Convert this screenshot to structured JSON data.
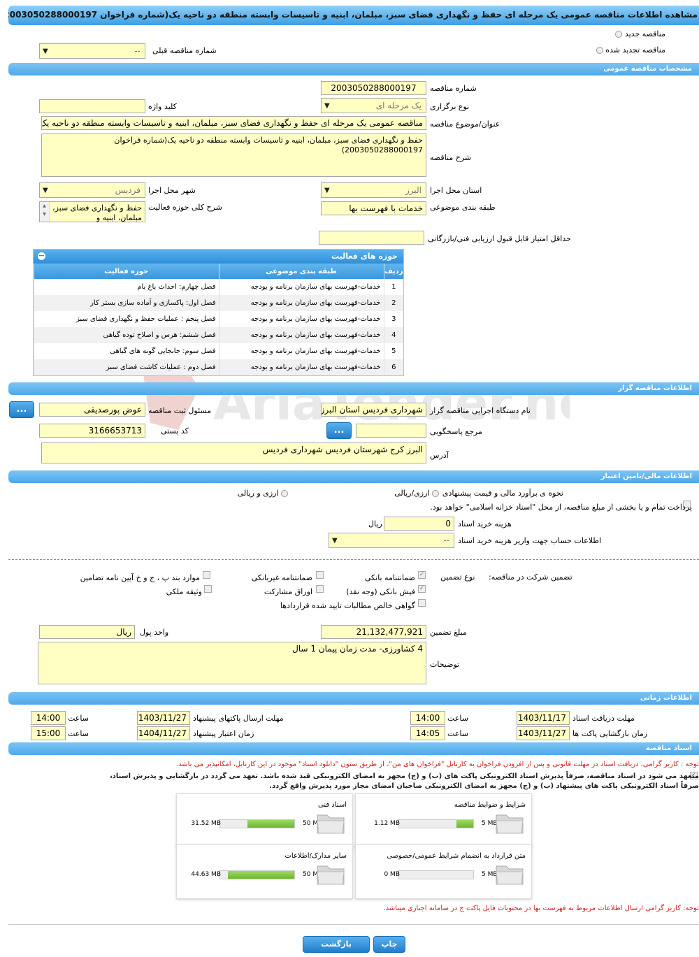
{
  "page_title": "مشاهده اطلاعات مناقصه عمومی یک مرحله ای حفظ و نگهداری فضای سبز، مبلمان، ابنیه و تاسیسات وابسته منطقه دو ناحیه یک(شماره فراخوان 2003050288000197)",
  "top": {
    "new_tender": "مناقصه جدید",
    "renewed_tender": "مناقصه تجدید شده",
    "prev_number_label": "شماره مناقصه قبلی",
    "prev_number_value": "--"
  },
  "general": {
    "section_title": "مشخصات مناقصه عمومی",
    "number_label": "شماره مناقصه",
    "number_value": "2003050288000197",
    "type_label": "نوع برگزاری",
    "type_value": "یک مرحله ای",
    "keyword_label": "کلید واژه",
    "keyword_value": "",
    "title_label": "عنوان/موضوع مناقصه",
    "title_value": "مناقصه عمومی یک مرحله ای حفظ و نگهداری فضای سبز، مبلمان، ابنیه و تاسیسات وابسته منطقه دو ناحیه یک",
    "desc_label": "شرح مناقصه",
    "desc_value": "حفظ و نگهداری فضای سبز، مبلمان، ابنیه و تاسیسات وابسته منطقه دو ناحیه یک(شماره فراخوان 2003050288000197)",
    "province_label": "استان محل اجرا",
    "province_value": "البرز",
    "city_label": "شهر محل اجرا",
    "city_value": "فردیس",
    "category_label": "طبقه بندی موضوعی",
    "category_value": "خدمات با فهرست بها",
    "activity_desc_label": "شرح کلی حوزه فعالیت",
    "activity_desc_value": "حفظ و نگهداری فضای سبز، مبلمان، ابنیه و",
    "min_score_label": "حداقل امتیاز قابل قبول ارزیابی فنی/بازرگانی",
    "min_score_value": ""
  },
  "activities": {
    "title": "حوزه های فعالیت",
    "columns": [
      "ردیف",
      "طبقه بندی موضوعی",
      "حوزه فعالیت"
    ],
    "rows": [
      {
        "n": "1",
        "cat": "خدمات-فهرست بهای سازمان برنامه و بودجه",
        "field": "فصل چهارم: احداث باغ بام"
      },
      {
        "n": "2",
        "cat": "خدمات-فهرست بهای سازمان برنامه و بودجه",
        "field": "فصل اول:  پاکسازی و آماده سازی بستر کار"
      },
      {
        "n": "3",
        "cat": "خدمات-فهرست بهای سازمان برنامه و بودجه",
        "field": "فصل پنجم : عملیات حفظ و نگهداری فضای سبز"
      },
      {
        "n": "4",
        "cat": "خدمات-فهرست بهای سازمان برنامه و بودجه",
        "field": "فصل ششم: هرس و اصلاح توده گیاهی"
      },
      {
        "n": "5",
        "cat": "خدمات-فهرست بهای سازمان برنامه و بودجه",
        "field": "فصل سوم: جابجایی گونه های گیاهی"
      },
      {
        "n": "6",
        "cat": "خدمات-فهرست بهای سازمان برنامه و بودجه",
        "field": "فصل دوم : عملیات کاشت فضای سبز"
      }
    ]
  },
  "organizer": {
    "section_title": "اطلاعات مناقصه گزار",
    "org_label": "نام دستگاه اجرایی مناقصه گزار",
    "org_value": "شهرداری فردیس استان البرز",
    "officer_label": "مسئول ثبت مناقصه",
    "officer_value": "عوض پورصدیقی",
    "respondent_label": "مرجع پاسخگویی",
    "respondent_value": "",
    "postal_label": "کد پستی",
    "postal_value": "3166653713",
    "address_label": "آدرس",
    "address_value": "البرز کرج شهرستان فردیس شهرداری فردیس",
    "more_button": "..."
  },
  "finance": {
    "section_title": "اطلاعات مالی/تامین اعتبار",
    "estimate_label": "نحوه ی برآورد مالی و قیمت پیشنهادی",
    "opt_rial": "ارزی/ریالی",
    "opt_fx": "ارزی و ریالی",
    "treasury_text": "پرداخت تمام و یا بخشی از مبلغ مناقصه، از محل \"اسناد خزانه اسلامی\" خواهد بود.",
    "fee_label": "هزینه خرید اسناد",
    "fee_value": "0",
    "fee_unit": "ریال",
    "account_label": "اطلاعات حساب جهت واریز هزینه خرید اسناد",
    "account_value": "--"
  },
  "guarantee": {
    "participation_label": "تضمین شرکت در مناقصه:",
    "type_label": "نوع تضمین",
    "opts": {
      "bank_guarantee": "ضمانتنامه بانکی",
      "non_bank": "ضمانتنامه غیربانکی",
      "clauses": "موارد بند پ ، ج و خ آیین نامه تضامین",
      "bank_receipt": "فیش بانکی (وجه نقد)",
      "bonds": "اوراق مشارکت",
      "property": "وثیقه ملکی",
      "net_claims": "گواهی خالص مطالبات تایید شده قراردادها"
    },
    "amount_label": "مبلغ تضمین",
    "amount_value": "21,132,477,921",
    "currency_label": "واحد پول",
    "currency_value": "ریال",
    "notes_label": "توضیحات",
    "notes_value": "4  کشاورزی- مدت زمان پیمان 1 سال"
  },
  "timing": {
    "section_title": "اطلاعات زمانی",
    "doc_receive_label": "مهلت دریافت اسناد",
    "doc_receive_date": "1403/11/17",
    "doc_receive_time": "14:00",
    "submit_label": "مهلت ارسال پاکتهای پیشنهاد",
    "submit_date": "1403/11/27",
    "submit_time": "14:00",
    "open_label": "زمان بازگشایی پاکت ها",
    "open_date": "1403/11/27",
    "open_time": "14:05",
    "validity_label": "زمان اعتبار پیشنهاد",
    "validity_date": "1404/11/27",
    "validity_time": "15:00",
    "time_label": "ساعت"
  },
  "documents": {
    "section_title": "اسناد مناقصه",
    "notice": "توجه : کاربر گرامی، دریافت اسناد در مهلت قانونی و پس از افزودن فراخوان به کارتابل \"فراخوان های من\"، از طریق ستون \"دانلود اسناد\" موجود در این کارتابل، امکانپذیر می باشد.",
    "commit_line1": "متعهد می شود در اسناد مناقصه، صرفاً پذیرش اسناد الکترونیکی پاکت های (ب) و (ج) مجهز به امضای الکترونیکی قید شده باشد. تعهد می گردد در بازگشایی و پذیرش اسناد،",
    "commit_line2": "صرفاً اسناد الکترونیکی پاکت های پیشنهاد (ب) و (ج) مجهز به امضای الکترونیکی صاحبان امضای مجاز مورد پذیرش واقع گردد.",
    "cards": [
      {
        "title": "شرایط و ضوابط مناقصه",
        "current": "1.12 MB",
        "max": "5 MB",
        "fill": 0.22
      },
      {
        "title": "اسناد فنی",
        "current": "31.52 MB",
        "max": "50 MB",
        "fill": 0.63
      },
      {
        "title": "متن قرارداد به انضمام شرایط عمومی/خصوصی",
        "current": "0 MB",
        "max": "5 MB",
        "fill": 0
      },
      {
        "title": "سایر مدارک/اطلاعات",
        "current": "44.63 MB",
        "max": "50 MB",
        "fill": 0.89
      }
    ],
    "footer_notice": "توجه: کاربر گرامی ارسال اطلاعات مربوط به فهرست بها در محتویات فایل پاکت ج در سامانه اجباری میباشد."
  },
  "actions": {
    "print": "چاپ",
    "back": "بازگشت"
  },
  "watermark": "AriaTender.neT",
  "colors": {
    "accent": "#3b9ee4",
    "field": "#ffffc4",
    "notice": "#d32020"
  }
}
